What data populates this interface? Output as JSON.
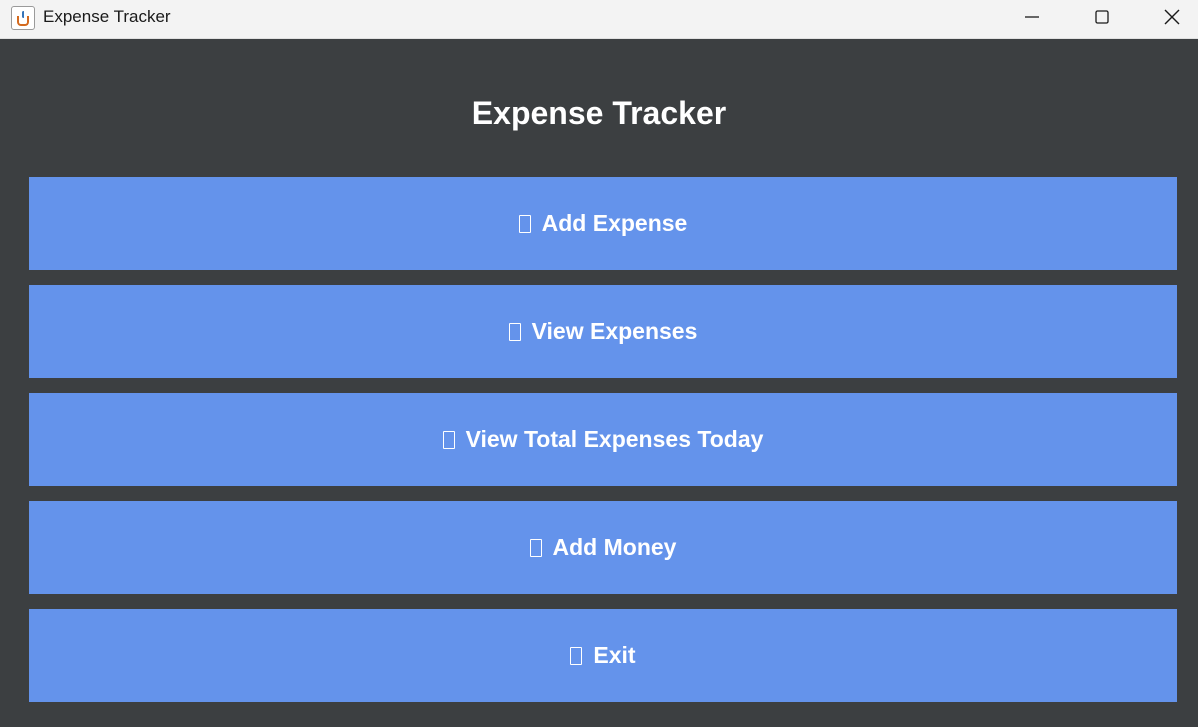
{
  "window": {
    "title": "Expense Tracker",
    "icon": "java-cup-icon",
    "controls": [
      "minimize-icon",
      "maximize-icon",
      "close-icon"
    ]
  },
  "main": {
    "heading": "Expense Tracker",
    "buttons": [
      {
        "label": "Add Expense",
        "icon": "missing-glyph-icon"
      },
      {
        "label": "View Expenses",
        "icon": "missing-glyph-icon"
      },
      {
        "label": "View Total Expenses Today",
        "icon": "missing-glyph-icon"
      },
      {
        "label": "Add Money",
        "icon": "missing-glyph-icon"
      },
      {
        "label": "Exit",
        "icon": "missing-glyph-icon"
      }
    ]
  },
  "colors": {
    "background": "#3c3f41",
    "button": "#6493eb",
    "text": "#ffffff",
    "titlebar": "#f3f3f3"
  }
}
